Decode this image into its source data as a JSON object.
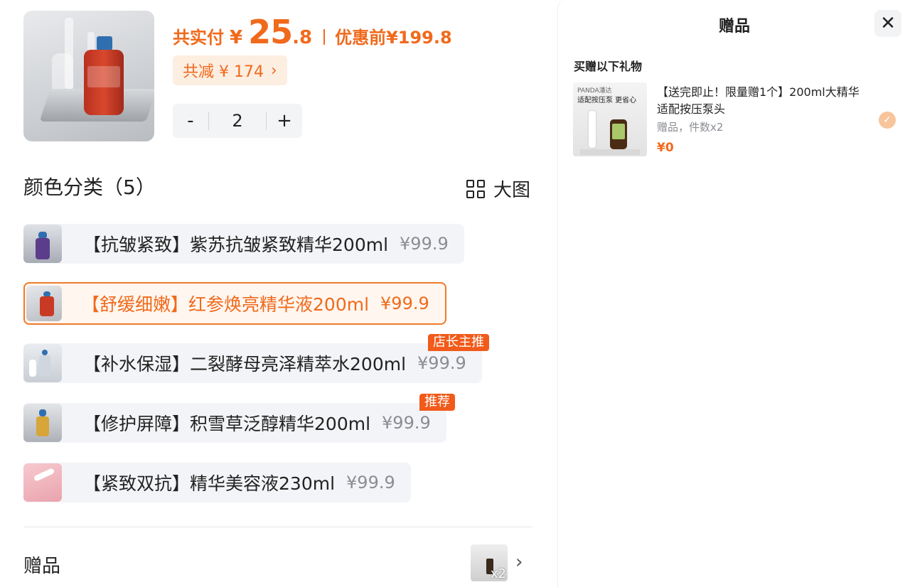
{
  "summary": {
    "total_label": "共实付",
    "currency": "¥",
    "total_int": "25",
    "total_dec": ".8",
    "original_label": "优惠前",
    "original_price": "¥199.8",
    "discount_text": "共减 ¥ 174",
    "discount_chevron": "›"
  },
  "quantity": {
    "minus": "-",
    "value": "2",
    "plus": "+"
  },
  "variants_section": {
    "title": "颜色分类（5）",
    "big_view_label": "大图",
    "items": [
      {
        "name": "【抗皱紧致】紫苏抗皱紧致精华200ml",
        "price": "¥99.9",
        "selected": false,
        "tag": ""
      },
      {
        "name": "【舒缓细嫩】红参焕亮精华液200ml",
        "price": "¥99.9",
        "selected": true,
        "tag": ""
      },
      {
        "name": "【补水保湿】二裂酵母亮泽精萃水200ml",
        "price": "¥99.9",
        "selected": false,
        "tag": "店长主推"
      },
      {
        "name": "【修护屏障】积雪草泛醇精华200ml",
        "price": "¥99.9",
        "selected": false,
        "tag": "推荐"
      },
      {
        "name": "【紧致双抗】精华美容液230ml",
        "price": "¥99.9",
        "selected": false,
        "tag": ""
      }
    ]
  },
  "gift_row": {
    "label": "赠品",
    "qty": "x2",
    "chevron": "›"
  },
  "gift_panel": {
    "title": "赠品",
    "close": "✕",
    "subtitle": "买赠以下礼物",
    "item": {
      "thumb_brand": "PANDA潘达",
      "thumb_caption": "适配按压泵 更省心",
      "name": "【送完即止！限量赠1个】200ml大精华适配按压泵头",
      "meta": "赠品，件数x2",
      "price": "¥0",
      "check": "✓"
    }
  },
  "colors": {
    "accent": "#f06a1c",
    "tag_bg": "#f15a1a",
    "chip_bg": "#fdeee2"
  }
}
